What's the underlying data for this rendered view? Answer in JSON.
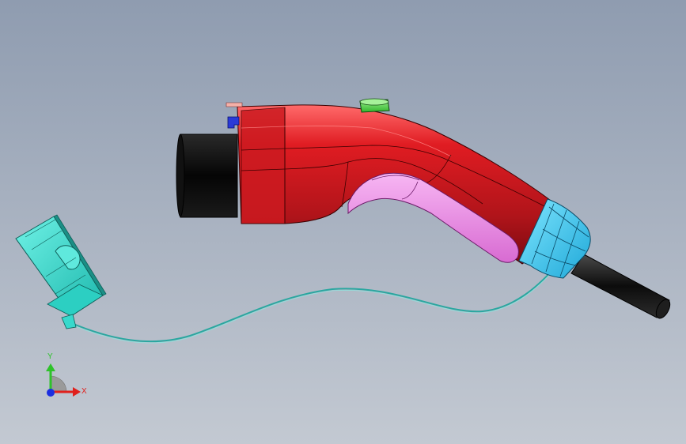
{
  "viewport": {
    "background_top": "#8f9cb0",
    "background_bottom": "#c3c9d2"
  },
  "model": {
    "parts": [
      {
        "name": "connector-body",
        "color": "#c2141a"
      },
      {
        "name": "connector-head",
        "color": "#0b0b0b"
      },
      {
        "name": "grip-insert",
        "color": "#e58ae0"
      },
      {
        "name": "cable-collar",
        "color": "#3ec9ea"
      },
      {
        "name": "release-button",
        "color": "#4fd04a"
      },
      {
        "name": "latch-clip",
        "color": "#2a3ad8"
      },
      {
        "name": "dust-cap",
        "color": "#2fd3c6"
      },
      {
        "name": "tether-cord",
        "color": "#2aa7a0"
      },
      {
        "name": "power-cable",
        "color": "#151515"
      }
    ]
  },
  "triad": {
    "x_label": "X",
    "y_label": "Y",
    "x_color": "#e0201c",
    "y_color": "#2ec22a",
    "z_color": "#1c2ee0"
  }
}
